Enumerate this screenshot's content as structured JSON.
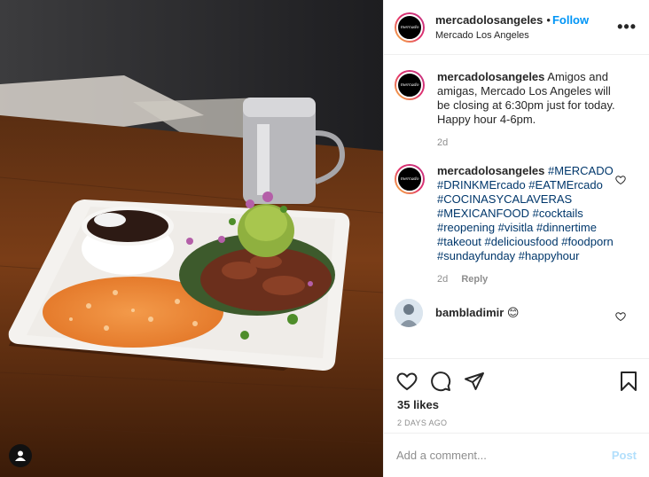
{
  "post": {
    "username": "mercadolosangeles",
    "follow_label": "Follow",
    "location": "Mercado Los Angeles",
    "avatar_text": "mercado"
  },
  "comments": [
    {
      "user": "mercadolosangeles",
      "text": "Amigos and amigas, Mercado Los Angeles will be closing at 6:30pm just for today. Happy hour 4-6pm.",
      "time": "2d"
    },
    {
      "user": "mercadolosangeles",
      "hashtags": "#MERCADO #DRINKMErcado #EATMErcado #COCINASYCALAVERAS #MEXICANFOOD #cocktails #reopening #visitla #dinnertime #takeout #deliciousfood #foodporn #sundayfunday #happyhour",
      "time": "2d",
      "reply_label": "Reply"
    },
    {
      "user": "bambladimir",
      "text": "😊"
    }
  ],
  "likes": "35 likes",
  "date": "2 DAYS AGO",
  "add_comment": {
    "placeholder": "Add a comment...",
    "post_label": "Post"
  },
  "colors": {
    "follow": "#0095f6",
    "hashtag": "#00376b",
    "post_disabled": "#b2dffc",
    "muted": "#8e8e8e"
  },
  "icons": [
    "heart-icon",
    "comment-icon",
    "share-icon",
    "bookmark-icon",
    "more-icon"
  ]
}
